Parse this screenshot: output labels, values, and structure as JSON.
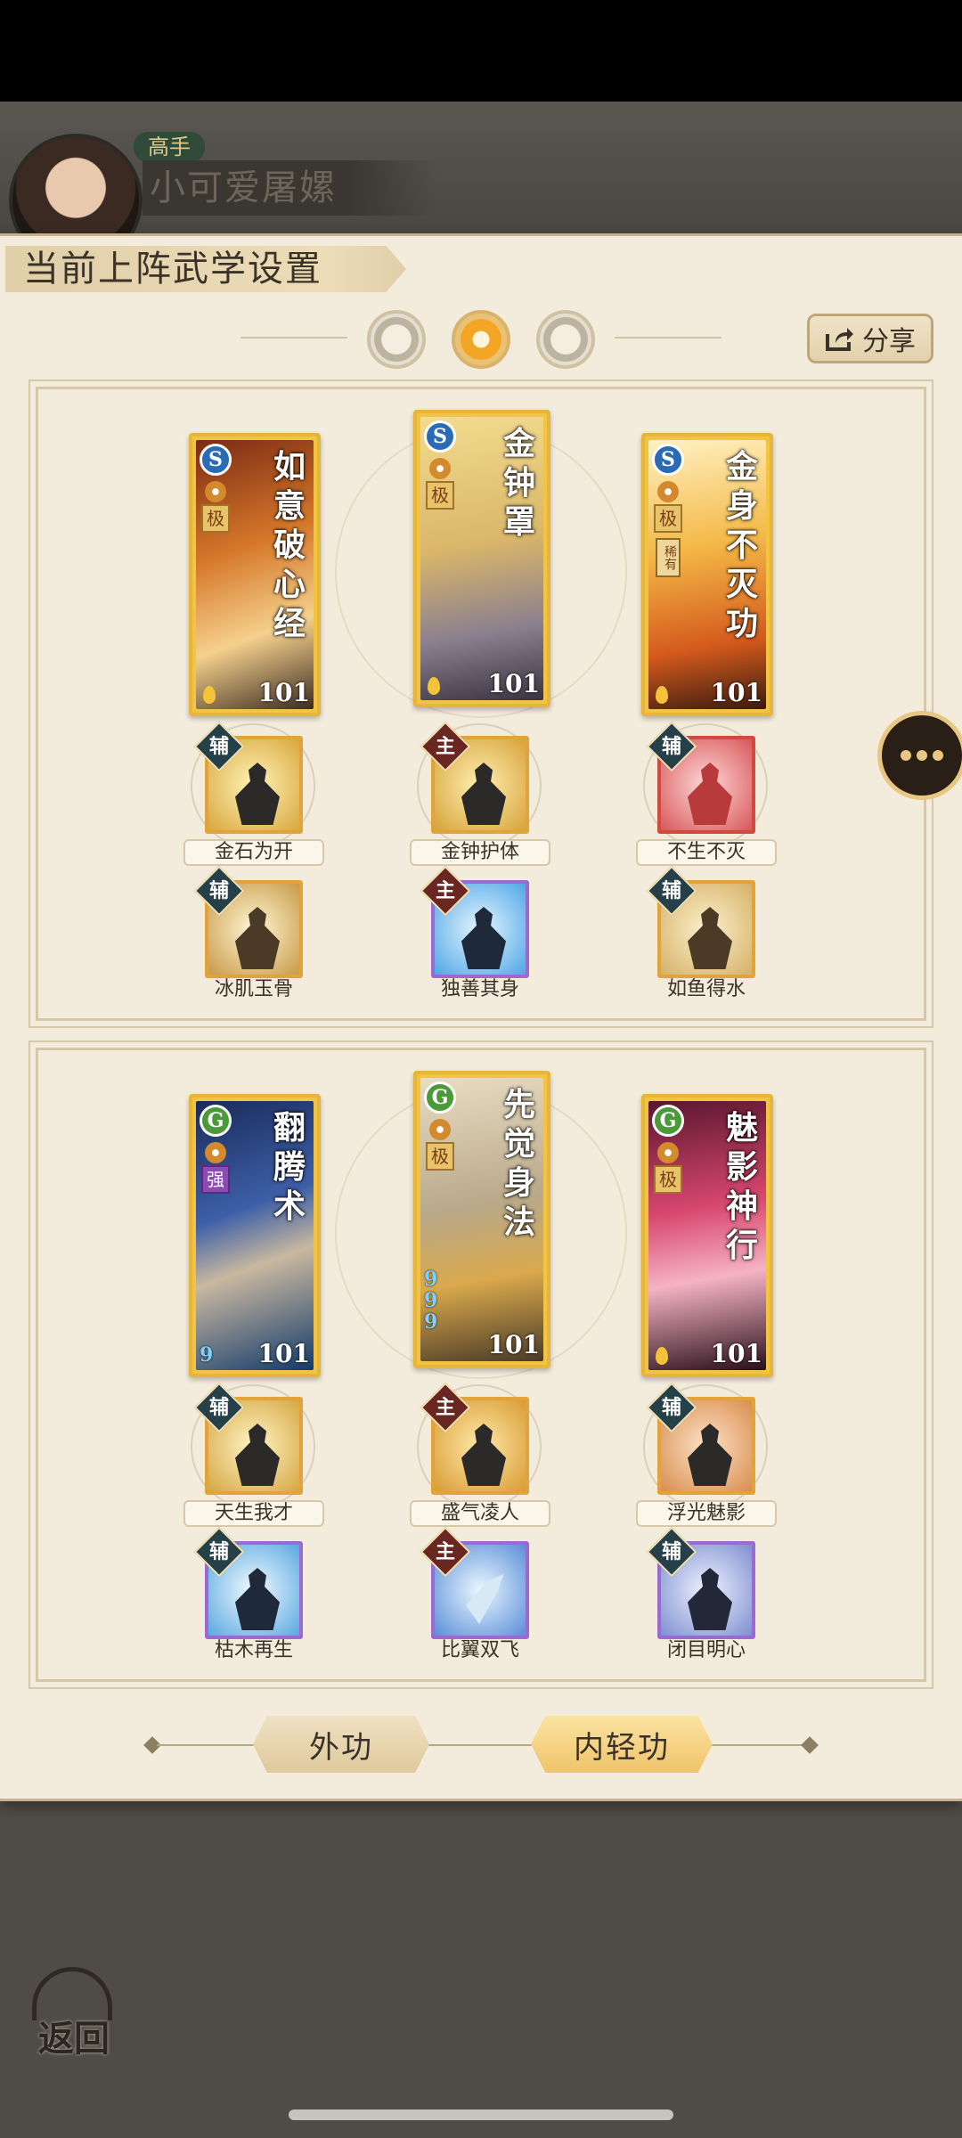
{
  "player": {
    "rank": "高手",
    "name": "小可爱屠嫘"
  },
  "title": "当前上阵武学设置",
  "share_label": "分享",
  "page_dots": [
    "moon-icon",
    "sun-icon",
    "ring-icon"
  ],
  "sections": [
    {
      "cards": [
        {
          "name": "如意破心经",
          "type": "S",
          "grade": "极",
          "rare": "",
          "level": "101",
          "qi": ""
        },
        {
          "name": "金钟罩",
          "type": "S",
          "grade": "极",
          "rare": "",
          "level": "101",
          "qi": ""
        },
        {
          "name": "金身不灭功",
          "type": "S",
          "grade": "极",
          "rare": "稀有",
          "level": "101",
          "qi": ""
        }
      ],
      "skills_row1": [
        {
          "role": "辅",
          "label": "金石为开",
          "frame": "gold"
        },
        {
          "role": "主",
          "label": "金钟护体",
          "frame": "gold"
        },
        {
          "role": "辅",
          "label": "不生不灭",
          "frame": "red"
        }
      ],
      "skills_row2": [
        {
          "role": "辅",
          "label": "冰肌玉骨",
          "frame": "gold"
        },
        {
          "role": "主",
          "label": "独善其身",
          "frame": "purple"
        },
        {
          "role": "辅",
          "label": "如鱼得水",
          "frame": "gold"
        }
      ]
    },
    {
      "cards": [
        {
          "name": "翻腾术",
          "type": "G",
          "grade": "强",
          "rare": "",
          "level": "101",
          "qi": "9"
        },
        {
          "name": "先觉身法",
          "type": "G",
          "grade": "极",
          "rare": "",
          "level": "101",
          "qi": "999"
        },
        {
          "name": "魅影神行",
          "type": "G",
          "grade": "极",
          "rare": "",
          "level": "101",
          "qi": ""
        }
      ],
      "skills_row1": [
        {
          "role": "辅",
          "label": "天生我才",
          "frame": "gold"
        },
        {
          "role": "主",
          "label": "盛气凌人",
          "frame": "gold"
        },
        {
          "role": "辅",
          "label": "浮光魅影",
          "frame": "gold"
        }
      ],
      "skills_row2": [
        {
          "role": "辅",
          "label": "枯木再生",
          "frame": "purple"
        },
        {
          "role": "主",
          "label": "比翼双飞",
          "frame": "purple"
        },
        {
          "role": "辅",
          "label": "闭目明心",
          "frame": "purple"
        }
      ]
    }
  ],
  "tabs": {
    "outer": "外功",
    "inner": "内轻功",
    "active": "inner"
  },
  "back_label": "返回",
  "colors": {
    "panel": "#f3ecdd",
    "gold_frame": "#e6b53a",
    "active_tab": "#f0c46a"
  }
}
